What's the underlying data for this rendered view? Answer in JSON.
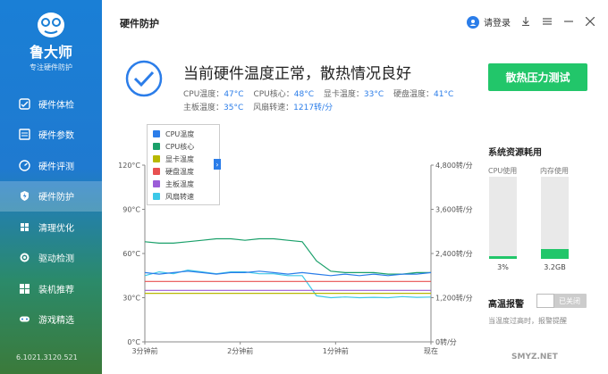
{
  "app": {
    "name": "鲁大师",
    "subtitle": "专注硬件防护",
    "version": "6.1021.3120.521"
  },
  "nav": [
    {
      "label": "硬件体检",
      "icon": "health-check-icon",
      "active": false
    },
    {
      "label": "硬件参数",
      "icon": "hardware-params-icon",
      "active": false
    },
    {
      "label": "硬件评测",
      "icon": "benchmark-icon",
      "active": false
    },
    {
      "label": "硬件防护",
      "icon": "protection-icon",
      "active": true
    },
    {
      "label": "清理优化",
      "icon": "cleanup-icon",
      "active": false
    },
    {
      "label": "驱动检测",
      "icon": "driver-icon",
      "active": false
    },
    {
      "label": "装机推荐",
      "icon": "recommend-icon",
      "active": false
    },
    {
      "label": "游戏精选",
      "icon": "game-icon",
      "active": false
    }
  ],
  "header": {
    "title": "硬件防护",
    "login": "请登录"
  },
  "status": {
    "title": "当前硬件温度正常，散热情况良好",
    "metrics_row1": [
      {
        "label": "CPU温度：",
        "value": "47°C"
      },
      {
        "label": "CPU核心：",
        "value": "48°C"
      },
      {
        "label": "显卡温度：",
        "value": "33°C"
      },
      {
        "label": "硬盘温度：",
        "value": "41°C"
      }
    ],
    "metrics_row2": [
      {
        "label": "主板温度：",
        "value": "35°C"
      },
      {
        "label": "风扇转速：",
        "value": "1217转/分"
      }
    ],
    "stress_button": "散热压力测试"
  },
  "legend": [
    {
      "label": "CPU温度",
      "color": "#2b7de9"
    },
    {
      "label": "CPU核心",
      "color": "#1aa06a"
    },
    {
      "label": "显卡温度",
      "color": "#b8b800"
    },
    {
      "label": "硬盘温度",
      "color": "#e85050"
    },
    {
      "label": "主板温度",
      "color": "#9b5cd8"
    },
    {
      "label": "风扇转速",
      "color": "#3cc8e8"
    }
  ],
  "chart_data": {
    "type": "line",
    "x": [
      "3分钟前",
      "2分钟前",
      "1分钟前",
      "现在"
    ],
    "y_left_ticks": [
      "0°C",
      "30°C",
      "60°C",
      "90°C",
      "120°C"
    ],
    "y_right_ticks": [
      "0转/分",
      "1,200转/分",
      "2,400转/分",
      "3,600转/分",
      "4,800转/分"
    ],
    "ylim": [
      0,
      120
    ],
    "y2lim": [
      0,
      4800
    ],
    "series": [
      {
        "name": "CPU核心",
        "color": "#1aa06a",
        "values": [
          68,
          67,
          67,
          68,
          69,
          70,
          70,
          69,
          70,
          70,
          69,
          68,
          55,
          48,
          47,
          47,
          47,
          46,
          46,
          47,
          47
        ]
      },
      {
        "name": "风扇转速",
        "color": "#3cc8e8",
        "values": [
          1800,
          1900,
          1850,
          1950,
          1900,
          1850,
          1900,
          1900,
          1850,
          1850,
          1800,
          1800,
          1250,
          1200,
          1220,
          1200,
          1210,
          1200,
          1230,
          1210,
          1217
        ]
      },
      {
        "name": "CPU温度",
        "color": "#2b7de9",
        "values": [
          47,
          46,
          47,
          48,
          47,
          46,
          47,
          47,
          48,
          47,
          46,
          47,
          46,
          45,
          46,
          45,
          46,
          45,
          46,
          46,
          47
        ]
      },
      {
        "name": "硬盘温度",
        "color": "#e85050",
        "values": [
          41,
          41,
          41,
          41,
          41,
          41,
          41,
          41,
          41,
          41,
          41,
          41,
          41,
          41,
          41,
          41,
          41,
          41,
          41,
          41,
          41
        ]
      },
      {
        "name": "主板温度",
        "color": "#9b5cd8",
        "values": [
          35,
          35,
          35,
          35,
          35,
          35,
          35,
          35,
          35,
          35,
          35,
          35,
          35,
          35,
          35,
          35,
          35,
          35,
          35,
          35,
          35
        ]
      },
      {
        "name": "显卡温度",
        "color": "#b8b800",
        "values": [
          33,
          33,
          33,
          33,
          33,
          33,
          33,
          33,
          33,
          33,
          33,
          33,
          33,
          33,
          33,
          33,
          33,
          33,
          33,
          33,
          33
        ]
      }
    ]
  },
  "resources": {
    "title": "系统资源耗用",
    "cpu_label": "CPU使用",
    "cpu_value": "3%",
    "cpu_fraction": 0.03,
    "mem_label": "内存使用",
    "mem_value": "3.2GB",
    "mem_fraction": 0.12
  },
  "alarm": {
    "title": "高温报警",
    "toggle_label": "已关闭",
    "desc": "当温度过高时，报警提醒"
  },
  "watermark": "SMYZ.NET",
  "colors": {
    "accent": "#2b7de9",
    "green": "#22c66a"
  }
}
